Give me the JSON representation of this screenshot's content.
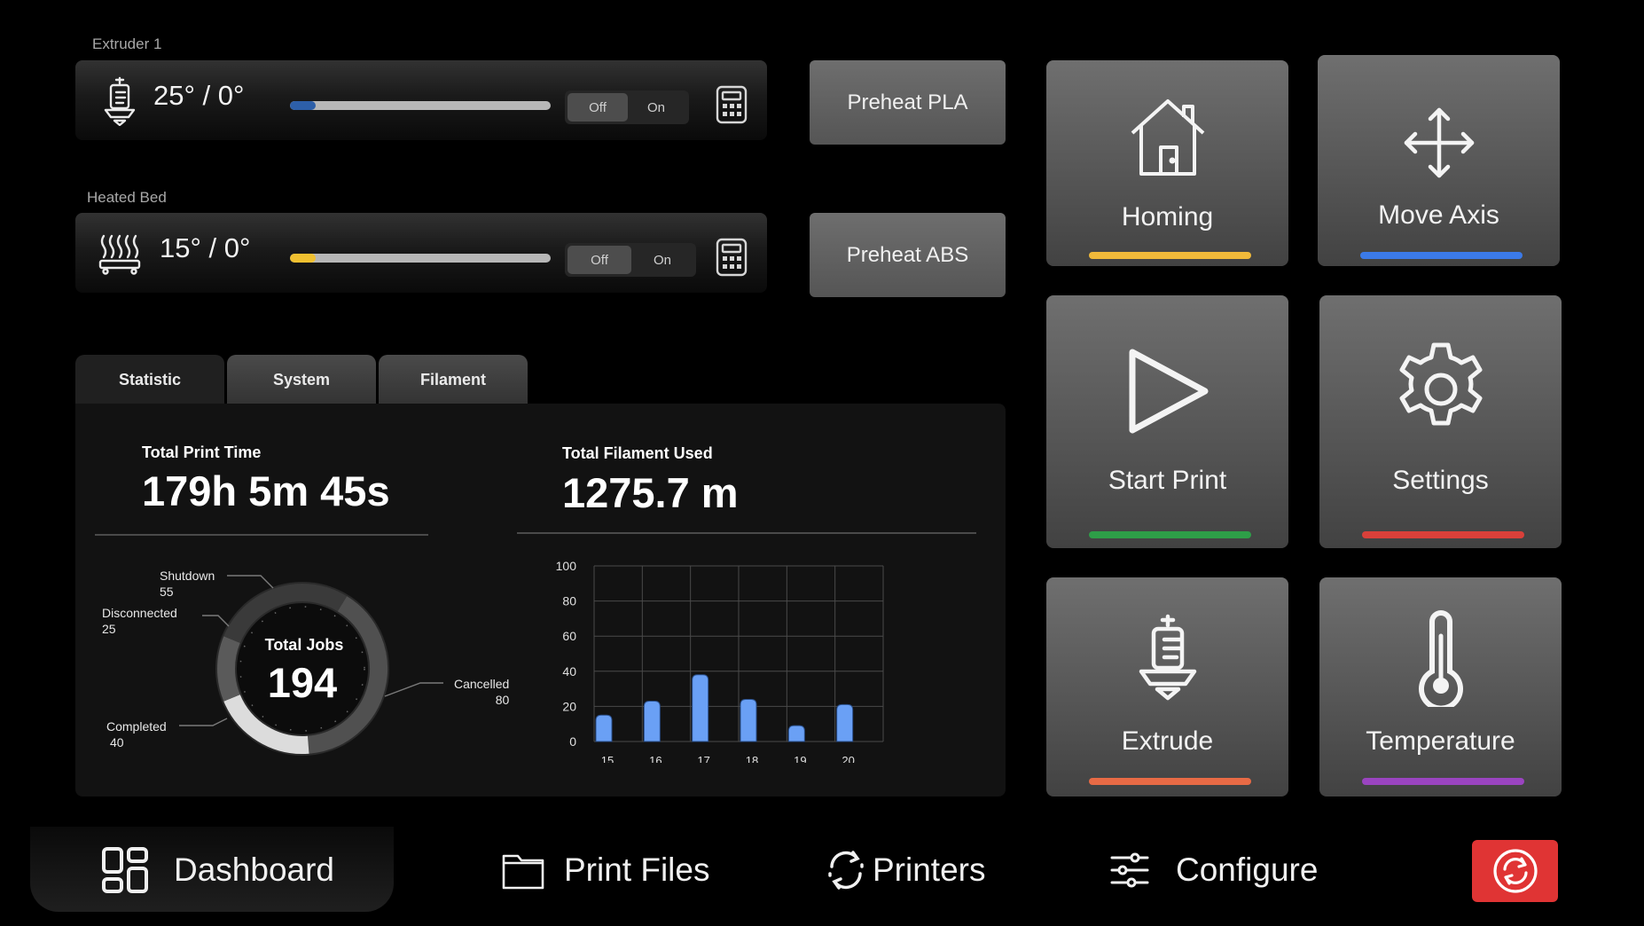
{
  "extruder": {
    "section_label": "Extruder 1",
    "temp": "25° / 0°",
    "progress": 0.1,
    "fill_color": "#2d5fa8",
    "toggle_off": "Off",
    "toggle_on": "On",
    "icon": "extruder-icon"
  },
  "bed": {
    "section_label": "Heated Bed",
    "temp": "15° / 0°",
    "progress": 0.1,
    "fill_color": "#f0c030",
    "toggle_off": "Off",
    "toggle_on": "On",
    "icon": "heated-bed-icon"
  },
  "preheat": {
    "pla_label": "Preheat PLA",
    "abs_label": "Preheat ABS"
  },
  "tiles": [
    {
      "label": "Homing",
      "icon": "home-icon",
      "color": "#f0b93a"
    },
    {
      "label": "Move Axis",
      "icon": "move-axis-icon",
      "color": "#3b7ae8"
    },
    {
      "label": "Start Print",
      "icon": "play-icon",
      "color": "#2e9e48"
    },
    {
      "label": "Settings",
      "icon": "gear-icon",
      "color": "#d9403a"
    },
    {
      "label": "Extrude",
      "icon": "extruder-icon",
      "color": "#e86a45"
    },
    {
      "label": "Temperature",
      "icon": "thermometer-icon",
      "color": "#9a44c0"
    }
  ],
  "tabs": [
    {
      "label": "Statistic",
      "active": true
    },
    {
      "label": "System",
      "active": false
    },
    {
      "label": "Filament",
      "active": false
    }
  ],
  "stats": {
    "print_time_label": "Total Print Time",
    "print_time_value": "179h 5m 45s",
    "filament_label": "Total Filament Used",
    "filament_value": "1275.7 m"
  },
  "chart_data": [
    {
      "type": "pie",
      "center_label": "Total Jobs",
      "center_value": "194",
      "categories": [
        "Shutdown",
        "Disconnected",
        "Cancelled",
        "Completed"
      ],
      "values": [
        55,
        25,
        80,
        40
      ],
      "colors": [
        "#3a3a3a",
        "#5a5a5a",
        "#505050",
        "#dcdcdc"
      ]
    },
    {
      "type": "bar",
      "categories": [
        "15",
        "16",
        "17",
        "18",
        "19",
        "20"
      ],
      "values": [
        15,
        23,
        38,
        24,
        9,
        21
      ],
      "ylim": [
        0,
        100
      ],
      "yticks": [
        "0",
        "20",
        "40",
        "60",
        "80",
        "100"
      ],
      "grid": true,
      "color": "#6aa0f5"
    }
  ],
  "nav": {
    "dashboard": "Dashboard",
    "print_files": "Print Files",
    "printers": "Printers",
    "configure": "Configure"
  }
}
